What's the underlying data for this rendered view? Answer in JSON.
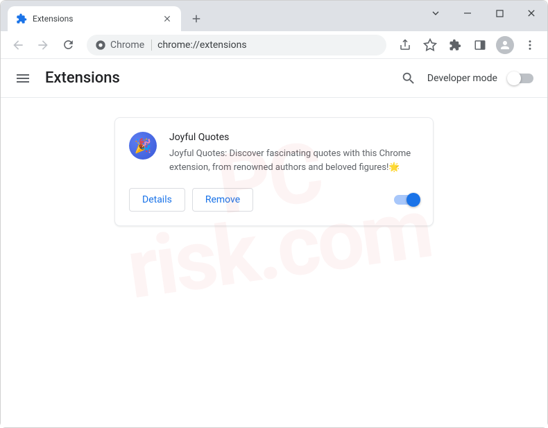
{
  "window": {
    "tab_title": "Extensions"
  },
  "addressbar": {
    "prefix_label": "Chrome",
    "url": "chrome://extensions"
  },
  "page": {
    "title": "Extensions",
    "dev_mode_label": "Developer mode"
  },
  "extension": {
    "name": "Joyful Quotes",
    "description": "Joyful Quotes: Discover fascinating quotes with this Chrome extension, from renowned authors and beloved figures!🌟",
    "details_label": "Details",
    "remove_label": "Remove",
    "enabled": true
  },
  "colors": {
    "accent": "#1a73e8"
  }
}
